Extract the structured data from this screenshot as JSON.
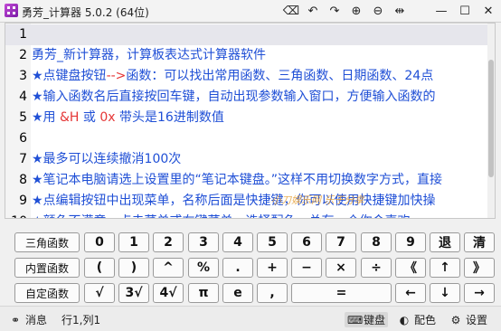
{
  "window": {
    "title": "勇芳_计算器 5.0.2 (64位)",
    "toolbar": [
      {
        "name": "eraser-icon",
        "glyph": "⌫"
      },
      {
        "name": "undo-icon",
        "glyph": "↶"
      },
      {
        "name": "redo-icon",
        "glyph": "↷"
      },
      {
        "name": "zoom-in-icon",
        "glyph": "⊕"
      },
      {
        "name": "zoom-out-icon",
        "glyph": "⊖"
      },
      {
        "name": "fit-width-icon",
        "glyph": "⇹"
      },
      {
        "name": "minimize-icon",
        "glyph": "—"
      },
      {
        "name": "maximize-icon",
        "glyph": "☐"
      },
      {
        "name": "close-icon",
        "glyph": "✕"
      }
    ]
  },
  "editor": {
    "lines": [
      {
        "n": "1",
        "segments": []
      },
      {
        "n": "2",
        "segments": [
          {
            "t": "勇芳_新计算器，计算板表达式计算器软件",
            "c": "blue"
          }
        ]
      },
      {
        "n": "3",
        "segments": [
          {
            "t": "★点键盘按钮",
            "c": "blue"
          },
          {
            "t": "-->",
            "c": "red"
          },
          {
            "t": "函数：可以找出常用函数、三角函数、日期函数、24点",
            "c": "blue"
          }
        ]
      },
      {
        "n": "4",
        "segments": [
          {
            "t": "★输入函数名后直接按回车键，自动出现参数输入窗口，方便输入函数的",
            "c": "blue"
          }
        ]
      },
      {
        "n": "5",
        "segments": [
          {
            "t": "★用 ",
            "c": "blue"
          },
          {
            "t": "&H",
            "c": "red"
          },
          {
            "t": " 或 ",
            "c": "blue"
          },
          {
            "t": "0x",
            "c": "red"
          },
          {
            "t": " 带头是16进制数值",
            "c": "blue"
          }
        ]
      },
      {
        "n": "6",
        "segments": []
      },
      {
        "n": "7",
        "segments": [
          {
            "t": "★最多可以连续撤消100次",
            "c": "blue"
          }
        ]
      },
      {
        "n": "8",
        "segments": [
          {
            "t": "★笔记本电脑请选上设置里的“笔记本键盘。”这样不用切换数字方式，直接",
            "c": "blue"
          }
        ]
      },
      {
        "n": "9",
        "segments": [
          {
            "t": "★点编辑按钮中出现菜单，名称后面是快捷键，你可以使用快捷键加快操",
            "c": "blue"
          }
        ]
      },
      {
        "n": "10",
        "segments": [
          {
            "t": "★颜色不满意，点击菜单或右键菜单，选择配色，总有一个你会喜欢",
            "c": "blue"
          }
        ]
      }
    ],
    "watermark": "小刀娱乐网 乐于分享"
  },
  "keyboard": {
    "rows": [
      [
        {
          "label": "三角函数",
          "name": "trig-functions-button"
        },
        {
          "label": "0",
          "name": "key-0"
        },
        {
          "label": "1",
          "name": "key-1"
        },
        {
          "label": "2",
          "name": "key-2"
        },
        {
          "label": "3",
          "name": "key-3"
        },
        {
          "label": "4",
          "name": "key-4"
        },
        {
          "label": "5",
          "name": "key-5"
        },
        {
          "label": "6",
          "name": "key-6"
        },
        {
          "label": "7",
          "name": "key-7"
        },
        {
          "label": "8",
          "name": "key-8"
        },
        {
          "label": "9",
          "name": "key-9"
        },
        {
          "label": "退",
          "name": "backspace-button"
        },
        {
          "label": "清",
          "name": "clear-button"
        }
      ],
      [
        {
          "label": "内置函数",
          "name": "builtin-functions-button"
        },
        {
          "label": "(",
          "name": "key-open-paren"
        },
        {
          "label": ")",
          "name": "key-close-paren"
        },
        {
          "label": "^",
          "name": "key-power"
        },
        {
          "label": "%",
          "name": "key-percent"
        },
        {
          "label": ".",
          "name": "key-dot"
        },
        {
          "label": "+",
          "name": "key-plus"
        },
        {
          "label": "−",
          "name": "key-minus"
        },
        {
          "label": "×",
          "name": "key-multiply"
        },
        {
          "label": "÷",
          "name": "key-divide"
        },
        {
          "label": "《",
          "name": "cursor-home-button"
        },
        {
          "label": "↑",
          "name": "arrow-up-button"
        },
        {
          "label": "》",
          "name": "cursor-end-button"
        }
      ],
      [
        {
          "label": "自定函数",
          "name": "custom-functions-button"
        },
        {
          "label": "√",
          "name": "key-sqrt"
        },
        {
          "label": "3√",
          "name": "key-cbrt"
        },
        {
          "label": "4√",
          "name": "key-4th-root"
        },
        {
          "label": "π",
          "name": "key-pi"
        },
        {
          "label": "e",
          "name": "key-e"
        },
        {
          "label": ",",
          "name": "key-comma"
        },
        {
          "label": "=",
          "name": "key-equals"
        },
        {
          "label": "←",
          "name": "arrow-left-button"
        },
        {
          "label": "↓",
          "name": "arrow-down-button"
        },
        {
          "label": "→",
          "name": "arrow-right-button"
        }
      ]
    ]
  },
  "status": {
    "message": "消息",
    "position": "行1,列1",
    "keyboard": "键盘",
    "colors": "配色",
    "settings": "设置"
  }
}
